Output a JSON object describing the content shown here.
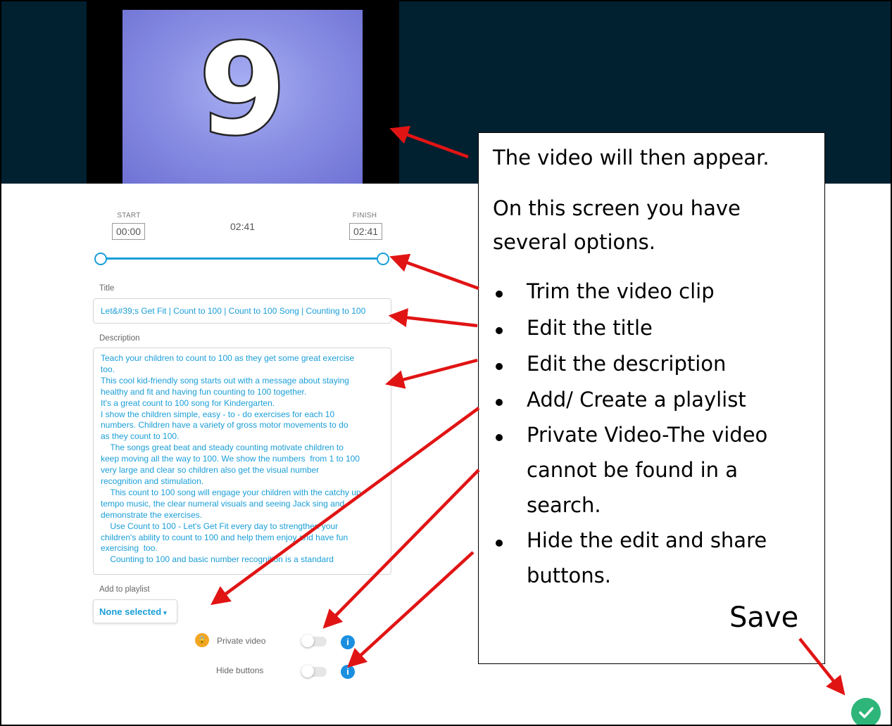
{
  "video": {
    "digit": "9"
  },
  "trim": {
    "start_label": "START",
    "start_value": "00:00",
    "duration": "02:41",
    "finish_label": "FINISH",
    "finish_value": "02:41"
  },
  "title_field": {
    "label": "Title",
    "value": "Let&#39;s Get Fit | Count to 100 | Count to 100 Song | Counting to 100"
  },
  "description_field": {
    "label": "Description",
    "value": "Teach your children to count to 100 as they get some great exercise\ntoo.\nThis cool kid-friendly song starts out with a message about staying\nhealthy and fit and having fun counting to 100 together.\nIt's a great count to 100 song for Kindergarten.\nI show the children simple, easy - to - do exercises for each 10\nnumbers. Children have a variety of gross motor movements to do\nas they count to 100.\n    The songs great beat and steady counting motivate children to\nkeep moving all the way to 100. We show the numbers  from 1 to 100\nvery large and clear so children also get the visual number\nrecognition and stimulation.\n    This count to 100 song will engage your children with the catchy up\ntempo music, the clear numeral visuals and seeing Jack sing and\ndemonstrate the exercises.\n    Use Count to 100 - Let's Get Fit every day to strengthen your\nchildren's ability to count to 100 and help them enjoy and have fun\nexercising  too.\n    Counting to 100 and basic number recognition is a standard"
  },
  "playlist": {
    "label": "Add to playlist",
    "value": "None selected"
  },
  "options": {
    "private_label": "Private video",
    "hide_label": "Hide buttons"
  },
  "callout": {
    "line1": "The video will then appear.",
    "line2": "On this screen you have",
    "line3": "several options.",
    "bullets": [
      "Trim the video clip",
      "Edit the title",
      "Edit the description",
      "Add/ Create a playlist",
      "Private Video-The video",
      "cannot be found in a",
      "search.",
      "Hide the edit and share",
      "buttons."
    ],
    "save": "Save"
  },
  "icons": {
    "private": "lock-icon",
    "info": "info-icon",
    "save": "checkmark-icon",
    "dropdown": "caret-down-icon"
  },
  "colors": {
    "accent": "#1a9ed8",
    "header_bg": "#012030",
    "save_green": "#2db57a",
    "arrow_red": "#e11414"
  }
}
